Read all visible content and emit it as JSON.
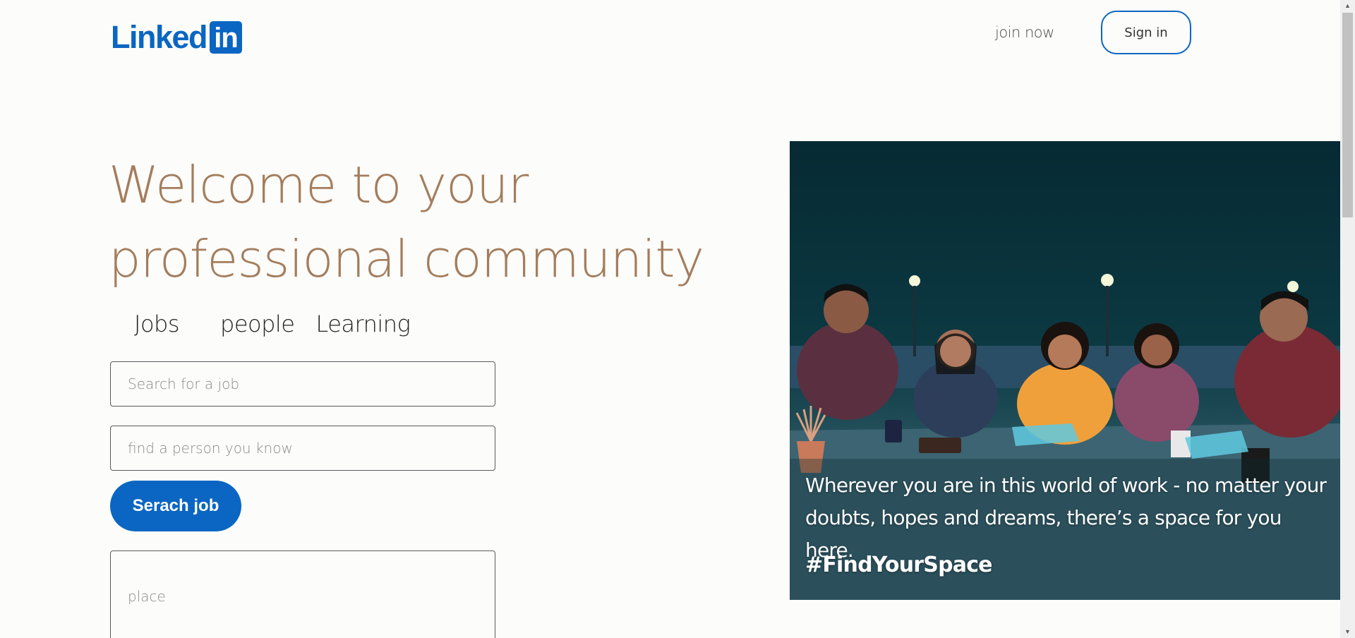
{
  "header": {
    "logo_text": "Linked",
    "logo_box_text": "in",
    "join_label": "join now",
    "signin_label": "Sign in"
  },
  "hero": {
    "title_line1": "Welcome to your",
    "title_line2": "professional community",
    "tabs": [
      "Jobs",
      "people",
      "Learning"
    ]
  },
  "form": {
    "job_placeholder": "Search for a job",
    "person_placeholder": "find a person you know",
    "search_button_label": "Serach job",
    "place_placeholder": "place"
  },
  "image": {
    "caption": "Wherever you are in this world of work - no matter your doubts, hopes and dreams, there’s a space for you here.",
    "hashtag": "#FindYourSpace"
  },
  "colors": {
    "brand_blue": "#0a66c2",
    "title_brown": "#a47d5d",
    "background": "#fcfcfa"
  },
  "icons": {
    "scroll_up": "scroll-up-arrow-icon",
    "scroll_down": "scroll-down-arrow-icon"
  }
}
